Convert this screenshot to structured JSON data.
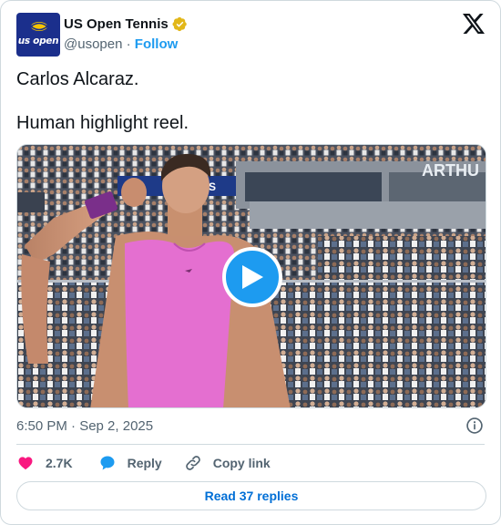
{
  "author": {
    "display_name": "US Open Tennis",
    "handle": "@usopen",
    "separator": "·",
    "follow_label": "Follow",
    "avatar_text": "us open",
    "verified": true
  },
  "tweet": {
    "lines": [
      "Carlos Alcaraz.",
      "Human highlight reel."
    ],
    "timestamp": "6:50 PM · Sep 2, 2025"
  },
  "media": {
    "type": "video",
    "stadium_sign": "ARTHU",
    "banner_fragment": "S"
  },
  "actions": {
    "likes": "2.7K",
    "reply_label": "Reply",
    "copy_label": "Copy link"
  },
  "read_replies_label": "Read 37 replies",
  "colors": {
    "accent": "#1d9bf0",
    "link": "#006fd6",
    "like": "#f91880",
    "muted": "#536471",
    "brand_blue": "#1b2f8c",
    "shirt": "#e46fd0"
  }
}
